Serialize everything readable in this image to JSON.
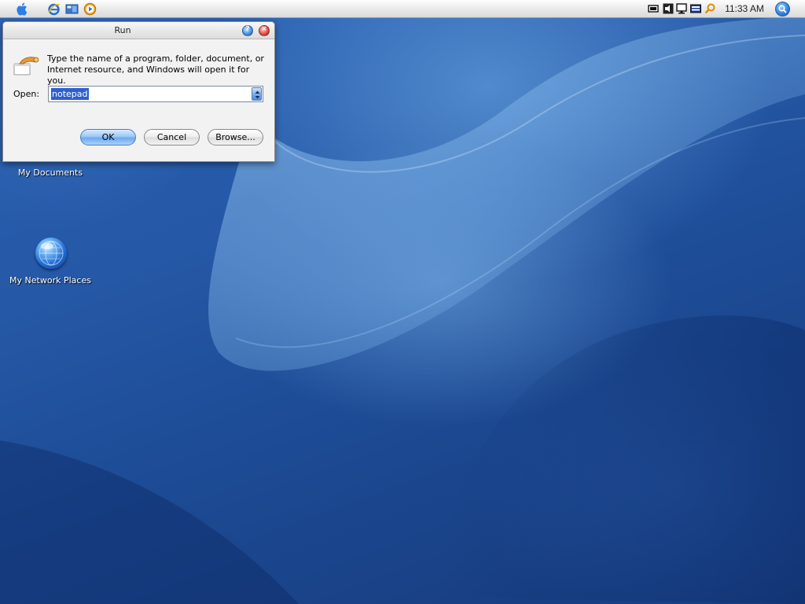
{
  "menubar": {
    "apple_icon": "apple-logo-icon",
    "quick_launch": [
      {
        "name": "internet-explorer-icon"
      },
      {
        "name": "show-desktop-icon"
      },
      {
        "name": "media-player-icon"
      }
    ],
    "tray": [
      {
        "name": "network-icon"
      },
      {
        "name": "volume-icon"
      },
      {
        "name": "display-icon"
      },
      {
        "name": "keyboard-icon"
      },
      {
        "name": "search-tool-icon"
      }
    ],
    "clock": "11:33 AM",
    "spotlight_icon": "spotlight-search-icon"
  },
  "desktop": {
    "icons": [
      {
        "label": "My Documents"
      },
      {
        "label": "My Network Places"
      }
    ]
  },
  "run_dialog": {
    "title": "Run",
    "description_line1": "Type the name of a program, folder, document, or",
    "description_line2": "Internet resource, and Windows will open it for you.",
    "open_label": "Open:",
    "open_value": "notepad",
    "ok_label": "OK",
    "cancel_label": "Cancel",
    "browse_label": "Browse..."
  },
  "colors": {
    "selection": "#2f5fcf",
    "wallpaper_dark": "#163a7c",
    "wallpaper_light": "#2a62b4"
  }
}
